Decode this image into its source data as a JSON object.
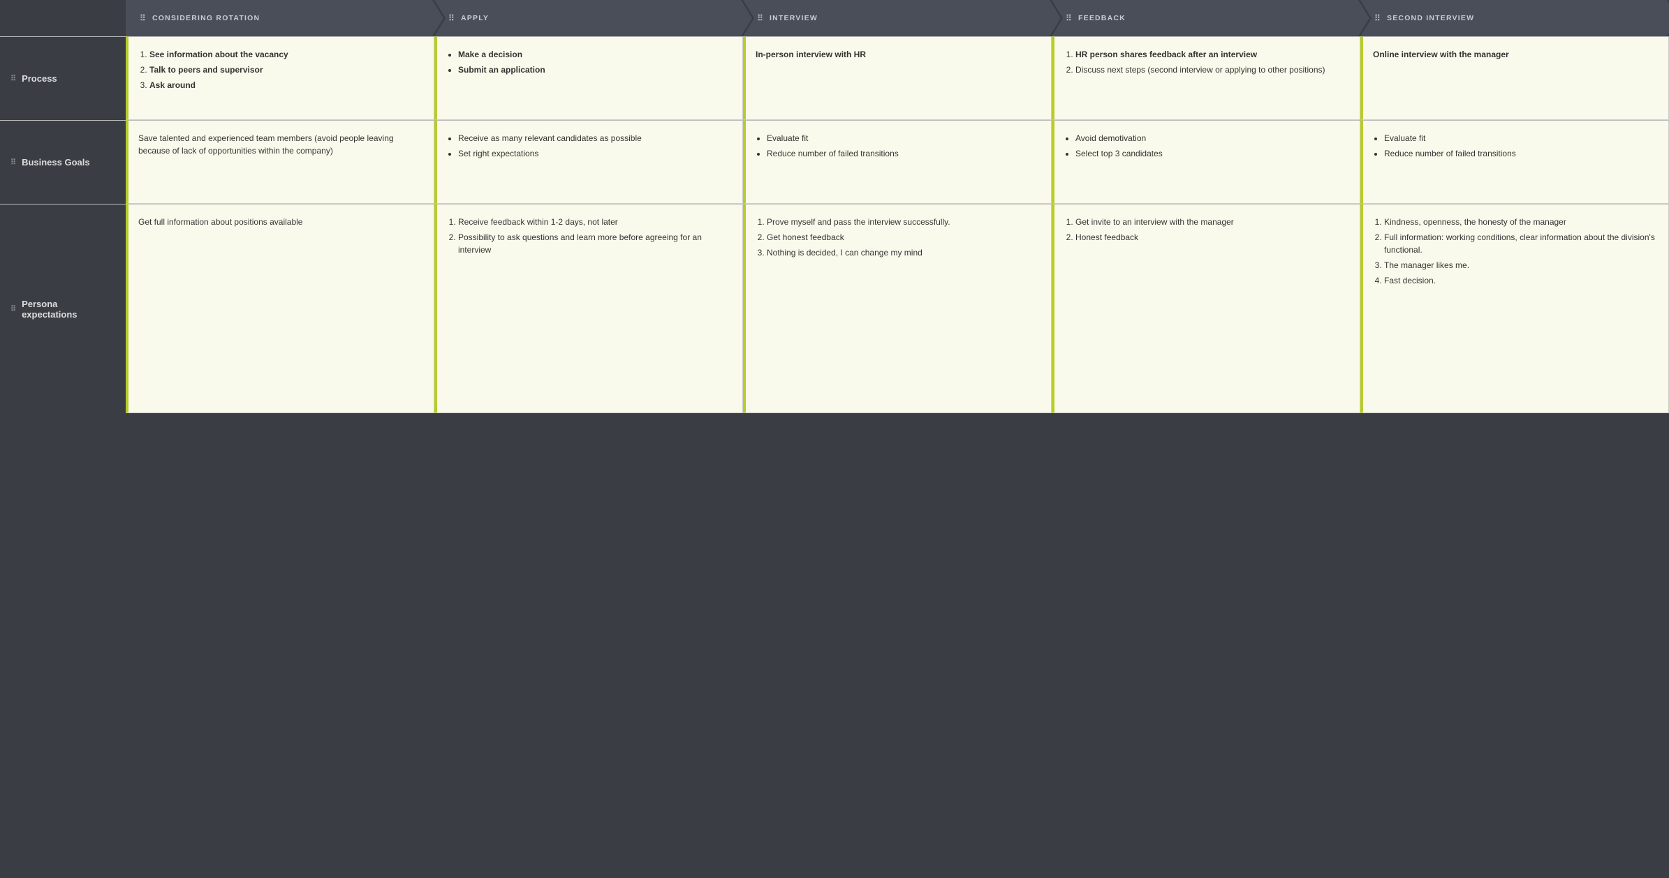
{
  "headers": {
    "corner": "",
    "col1": "CONSIDERING ROTATION",
    "col2": "APPLY",
    "col3": "INTERVIEW",
    "col4": "FEEDBACK",
    "col5": "SECOND INTERVIEW"
  },
  "rows": [
    {
      "label": "Process",
      "cells": [
        {
          "type": "ol",
          "items": [
            {
              "bold": true,
              "text": "See information about the vacancy"
            },
            {
              "bold": true,
              "text": "Talk to peers and supervisor"
            },
            {
              "bold": true,
              "text": "Ask around"
            }
          ]
        },
        {
          "type": "ul",
          "items": [
            {
              "bold": true,
              "text": "Make a decision"
            },
            {
              "bold": true,
              "text": "Submit an application"
            }
          ]
        },
        {
          "type": "plain",
          "text": "In-person interview with HR"
        },
        {
          "type": "ol",
          "items": [
            {
              "bold": true,
              "text": "HR person shares feedback after an interview"
            },
            {
              "bold": false,
              "text": "Discuss next steps (second interview or applying to other positions)"
            }
          ]
        },
        {
          "type": "plain",
          "text": "Online interview with the manager"
        }
      ]
    },
    {
      "label": "Business Goals",
      "cells": [
        {
          "type": "plain",
          "text": "Save talented and experienced team members (avoid people leaving because of lack of opportunities within the company)"
        },
        {
          "type": "ul",
          "items": [
            {
              "bold": false,
              "text": "Receive as many relevant candidates as possible"
            },
            {
              "bold": false,
              "text": "Set right expectations"
            }
          ]
        },
        {
          "type": "ul",
          "items": [
            {
              "bold": false,
              "text": "Evaluate fit"
            },
            {
              "bold": false,
              "text": "Reduce number of failed transitions"
            }
          ]
        },
        {
          "type": "ul",
          "items": [
            {
              "bold": false,
              "text": "Avoid demotivation"
            },
            {
              "bold": false,
              "text": "Select top 3 candidates"
            }
          ]
        },
        {
          "type": "ul",
          "items": [
            {
              "bold": false,
              "text": "Evaluate fit"
            },
            {
              "bold": false,
              "text": "Reduce number of failed transitions"
            }
          ]
        }
      ]
    },
    {
      "label": "Persona expectations",
      "cells": [
        {
          "type": "plain",
          "text": "Get full information about positions available"
        },
        {
          "type": "ol",
          "items": [
            {
              "bold": false,
              "text": "Receive feedback within 1-2 days, not later"
            },
            {
              "bold": false,
              "text": "Possibility to ask questions and learn more before agreeing for an interview"
            }
          ]
        },
        {
          "type": "ol",
          "items": [
            {
              "bold": false,
              "text": "Prove myself and pass the interview successfully."
            },
            {
              "bold": false,
              "text": "Get honest feedback"
            },
            {
              "bold": false,
              "text": "Nothing is decided, I can change my mind"
            }
          ]
        },
        {
          "type": "ol",
          "items": [
            {
              "bold": false,
              "text": "Get invite to an interview with the manager"
            },
            {
              "bold": false,
              "text": "Honest feedback"
            }
          ]
        },
        {
          "type": "ol",
          "items": [
            {
              "bold": false,
              "text": "Kindness, openness, the honesty of the manager"
            },
            {
              "bold": false,
              "text": "Full information: working conditions, clear information about the division's functional."
            },
            {
              "bold": false,
              "text": "The manager likes me."
            },
            {
              "bold": false,
              "text": "Fast decision."
            }
          ]
        }
      ]
    }
  ]
}
